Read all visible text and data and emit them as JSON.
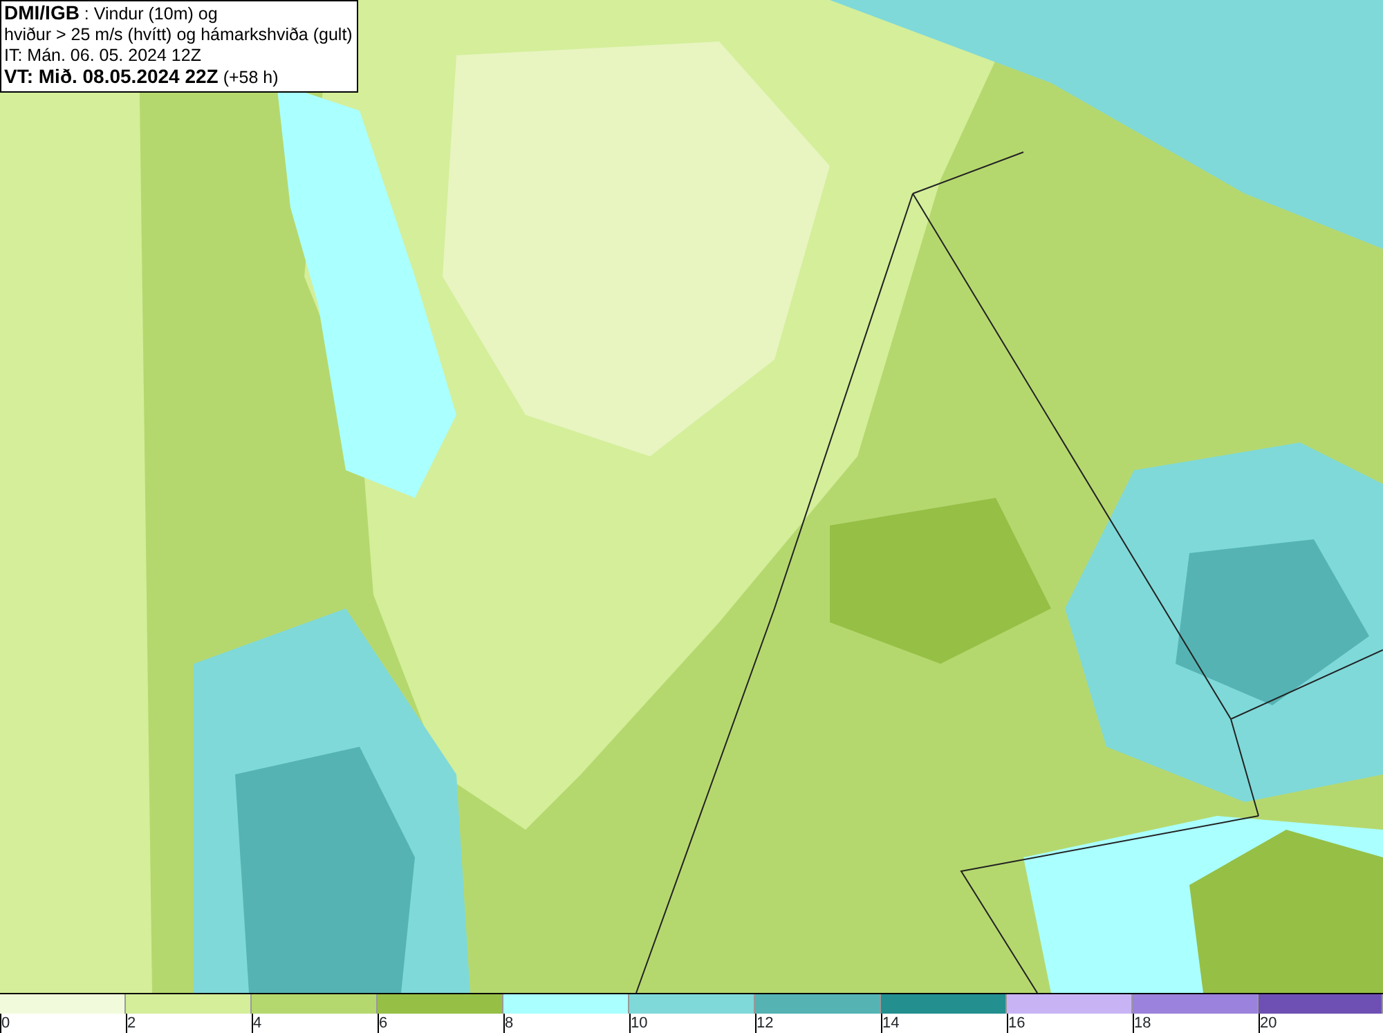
{
  "info_box": {
    "lines": [
      "**DMI/IGB** : Vindur (10m) og",
      "hviður > 25 m/s (hvítt) og hámarkshviða (gult)",
      "IT: Mán. 06. 05. 2024 12Z",
      "**VT: Mið. 08.05.2024 22Z** (+58 h)"
    ]
  },
  "legend": [
    {
      "label": "0",
      "color": "#f2fadc"
    },
    {
      "label": "2",
      "color": "#d4ee9a"
    },
    {
      "label": "4",
      "color": "#b5d86e"
    },
    {
      "label": "6",
      "color": "#96bf46"
    },
    {
      "label": "8",
      "color": "#aaffff"
    },
    {
      "label": "10",
      "color": "#7fd9d9"
    },
    {
      "label": "12",
      "color": "#55b3b3"
    },
    {
      "label": "14",
      "color": "#238f8f"
    },
    {
      "label": "16",
      "color": "#c8b4f5"
    },
    {
      "label": "18",
      "color": "#9b82dc"
    },
    {
      "label": "20",
      "color": "#6e50b4"
    }
  ]
}
